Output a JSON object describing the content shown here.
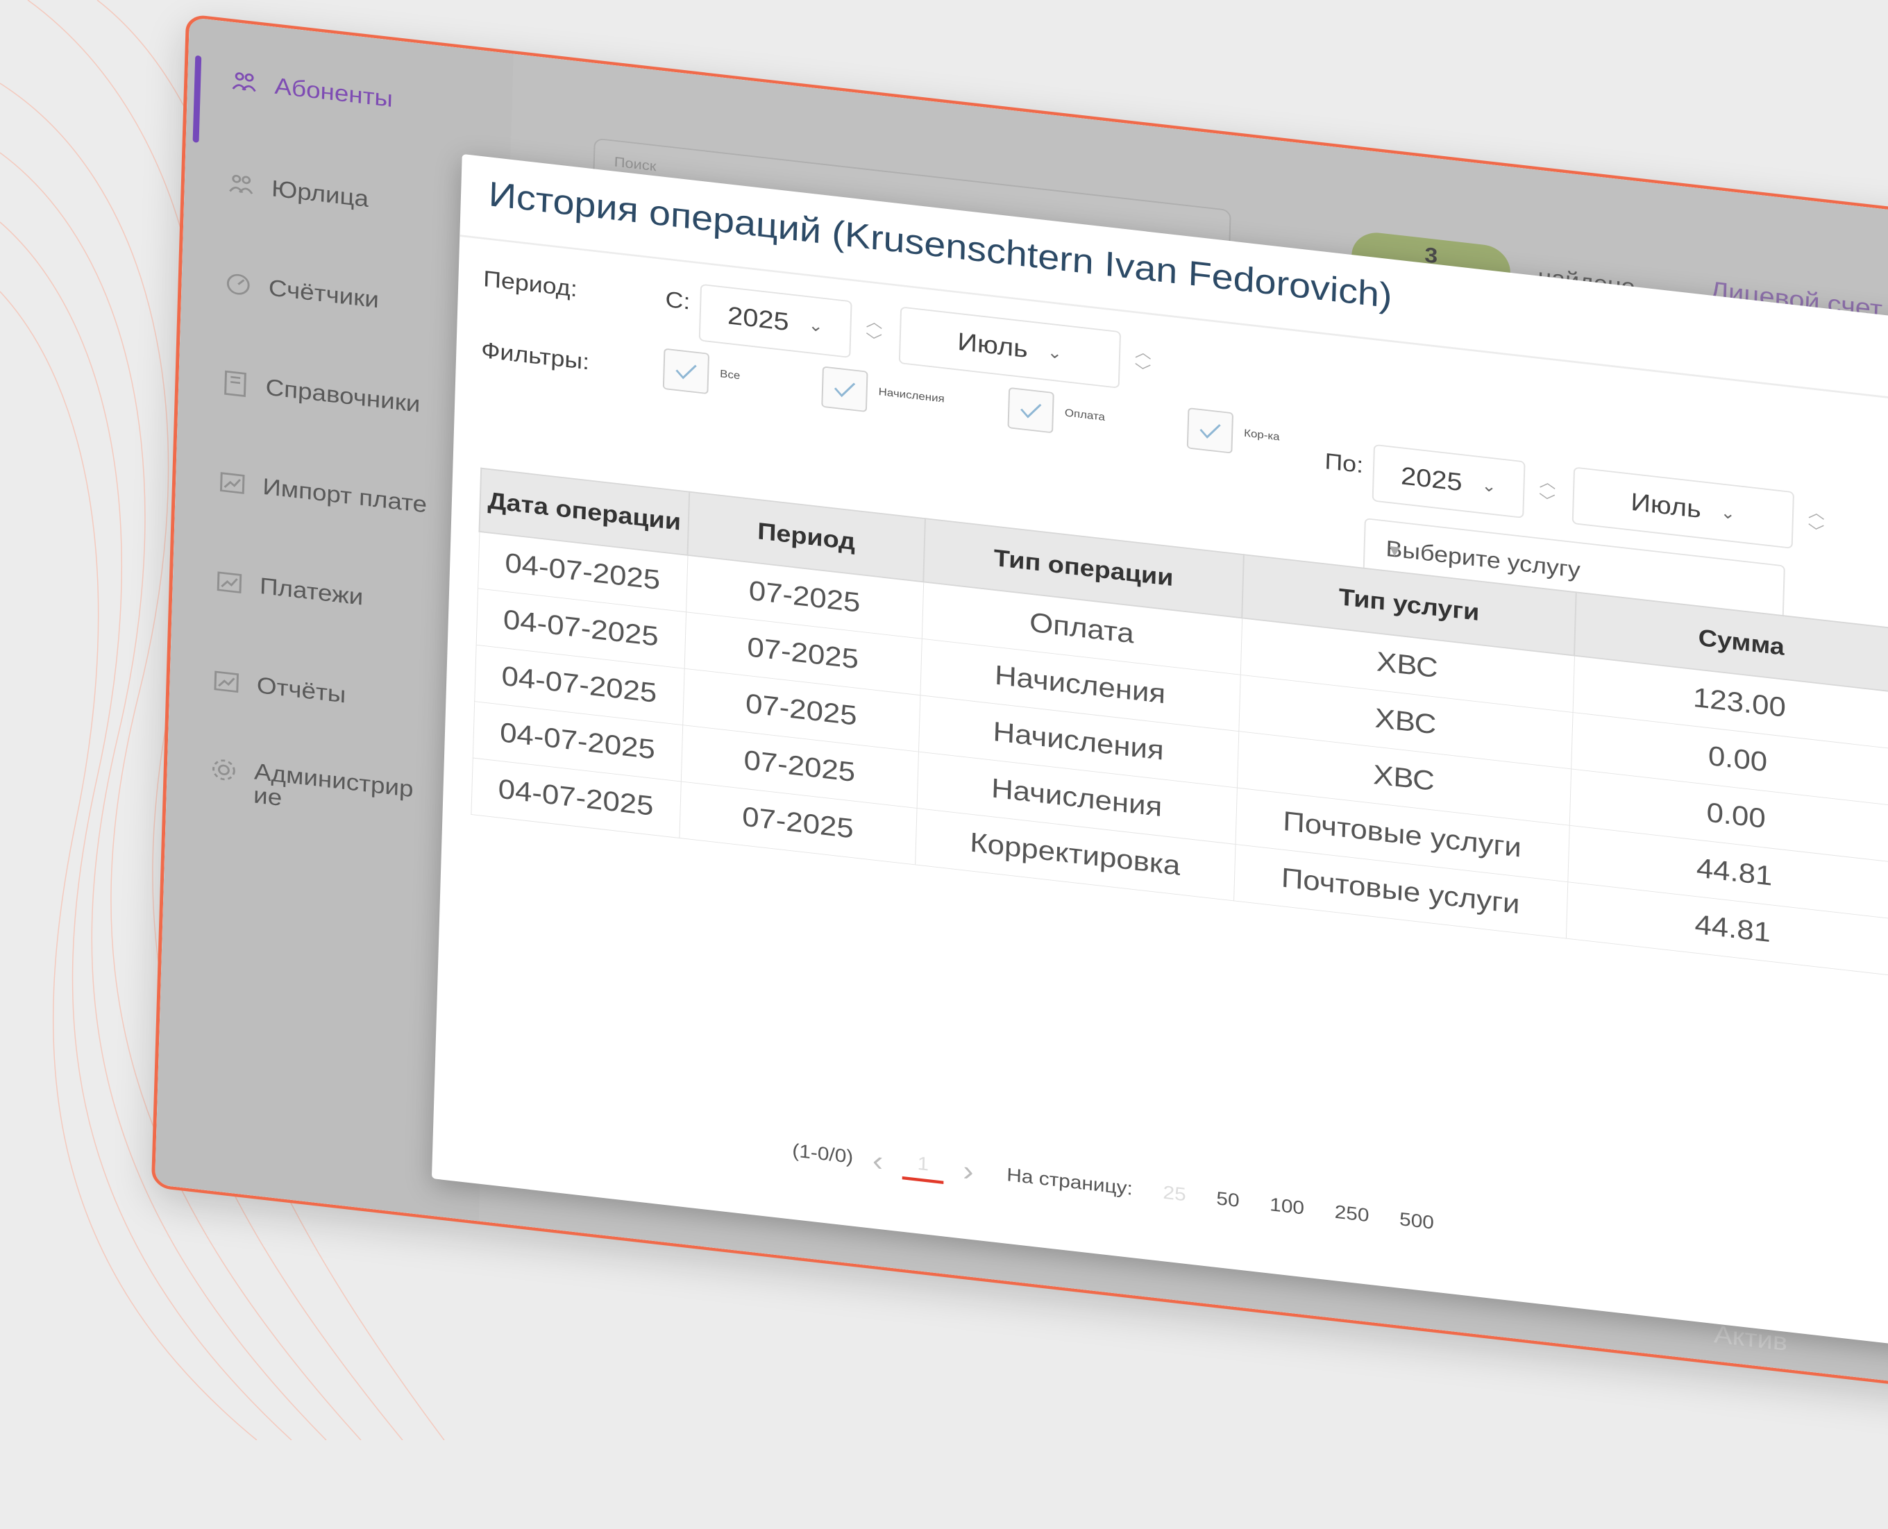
{
  "sidebar": {
    "items": [
      {
        "label": "Абоненты",
        "icon": "users-icon",
        "active": true
      },
      {
        "label": "Юрлица",
        "icon": "users-icon"
      },
      {
        "label": "Счётчики",
        "icon": "gauge-icon"
      },
      {
        "label": "Справочники",
        "icon": "book-icon"
      },
      {
        "label": "Импорт плате",
        "icon": "chart-icon"
      },
      {
        "label": "Платежи",
        "icon": "chart-icon"
      },
      {
        "label": "Отчёты",
        "icon": "chart-icon"
      },
      {
        "label": "Администрир ие",
        "icon": "gear-icon"
      }
    ]
  },
  "background": {
    "search_placeholder": "Поиск",
    "found_count": "3",
    "found_label": "найдено",
    "account_label": "Лицевой счет",
    "footer_partial": "Актив"
  },
  "modal": {
    "title": "История операций (Krusenschtern Ivan Fedorovich)",
    "period_label": "Период:",
    "from_label": "С:",
    "to_label": "По:",
    "from_year": "2025",
    "from_month": "Июль",
    "to_year": "2025",
    "to_month": "Июль",
    "filters_label": "Фильтры:",
    "filters": [
      {
        "label": "Все",
        "checked": true
      },
      {
        "label": "Начисления",
        "checked": true
      },
      {
        "label": "Оплата",
        "checked": true
      },
      {
        "label": "Кор-ка",
        "checked": true
      }
    ],
    "service_placeholder": "Выберите услугу"
  },
  "table": {
    "columns": [
      "Дата операции",
      "Период",
      "Тип операции",
      "Тип услуги",
      "Сумма"
    ],
    "rows": [
      [
        "04-07-2025",
        "07-2025",
        "Оплата",
        "ХВС",
        "123.00"
      ],
      [
        "04-07-2025",
        "07-2025",
        "Начисления",
        "ХВС",
        "0.00"
      ],
      [
        "04-07-2025",
        "07-2025",
        "Начисления",
        "ХВС",
        "0.00"
      ],
      [
        "04-07-2025",
        "07-2025",
        "Начисления",
        "Почтовые услуги",
        "44.81"
      ],
      [
        "04-07-2025",
        "07-2025",
        "Корректировка",
        "Почтовые услуги",
        "44.81"
      ]
    ]
  },
  "pager": {
    "range": "(1-0/0)",
    "current_page": "1",
    "per_page_label": "На страницу:",
    "options": [
      "25",
      "50",
      "100",
      "250",
      "500"
    ]
  },
  "colors": {
    "accent": "#8a34e6",
    "frame": "#f06a4a",
    "found_pill": "#bcd873",
    "pager_underline": "#e23a2a"
  }
}
